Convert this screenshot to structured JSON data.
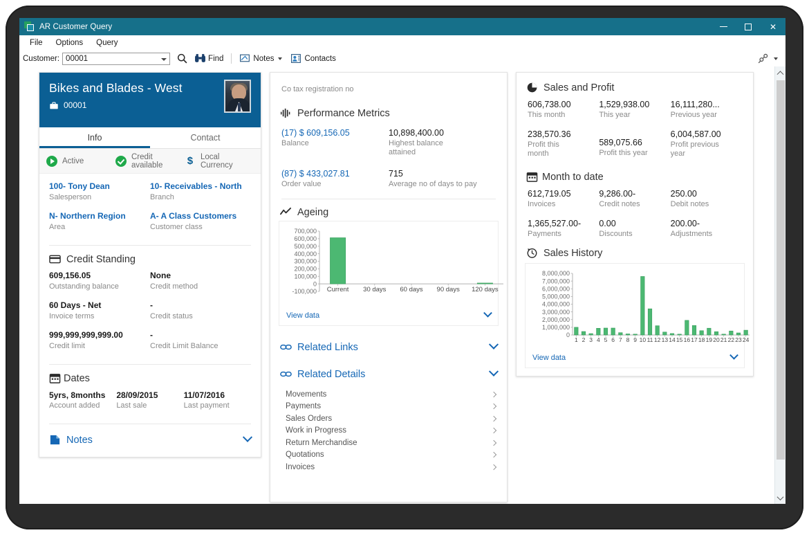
{
  "window": {
    "title": "AR Customer Query",
    "app_icon": "app-window-icon",
    "minimize": "minimize-icon",
    "maximize": "maximize-icon",
    "close": "close-icon"
  },
  "menubar": {
    "items": [
      {
        "label": "File",
        "accel": "F"
      },
      {
        "label": "Options",
        "accel": "O"
      },
      {
        "label": "Query",
        "accel": "Q"
      }
    ]
  },
  "toolbar": {
    "customer_label": "Customer:",
    "customer_value": "00001",
    "customer_placeholder": "Customer",
    "search_icon": "search-icon",
    "find_label": "Find",
    "find_icon": "binoculars-icon",
    "notes_label": "Notes",
    "notes_icon": "notes-icon",
    "contacts_label": "Contacts",
    "contacts_icon": "contacts-icon",
    "right_icon": "link-key-icon"
  },
  "customer_card": {
    "name": "Bikes and Blades - West",
    "code": "00001",
    "code_icon": "briefcase-icon",
    "avatar": "customer-avatar",
    "tabs": [
      {
        "label": "Info",
        "active": true
      },
      {
        "label": "Contact",
        "active": false
      }
    ],
    "status": [
      {
        "label": "Active",
        "icon": "play-circle-icon"
      },
      {
        "label": "Credit available",
        "icon": "check-circle-icon"
      },
      {
        "label": "Local Currency",
        "icon": "dollar-icon"
      }
    ],
    "attributes": [
      {
        "value": "100- Tony Dean",
        "label": "Salesperson",
        "link": true
      },
      {
        "value": "10- Receivables - North",
        "label": "Branch",
        "link": true
      },
      {
        "value": "N- Northern Region",
        "label": "Area",
        "link": true
      },
      {
        "value": "A- A Class Customers",
        "label": "Customer class",
        "link": true
      }
    ],
    "credit_standing": {
      "title": "Credit Standing",
      "icon": "credit-card-icon",
      "items": [
        {
          "value": "609,156.05",
          "label": "Outstanding balance"
        },
        {
          "value": "None",
          "label": "Credit method"
        },
        {
          "value": "60 Days - Net",
          "label": "Invoice terms"
        },
        {
          "value": "-",
          "label": "Credit status"
        },
        {
          "value": "999,999,999,999.00",
          "label": "Credit limit"
        },
        {
          "value": "-",
          "label": "Credit Limit Balance"
        }
      ]
    },
    "dates": {
      "title": "Dates",
      "icon": "calendar-icon",
      "items": [
        {
          "value": "5yrs, 8months",
          "label": "Account added"
        },
        {
          "value": "28/09/2015",
          "label": "Last sale"
        },
        {
          "value": "11/07/2016",
          "label": "Last payment"
        }
      ]
    },
    "notes": {
      "title": "Notes",
      "icon": "note-page-icon",
      "chevron": "chevron-down-icon"
    }
  },
  "middle_card": {
    "co_tax_label": "Co tax registration no",
    "performance": {
      "title": "Performance Metrics",
      "icon": "bar-levels-icon",
      "items": [
        {
          "value": "(17) $ 609,156.05",
          "label": "Balance",
          "link": true
        },
        {
          "value": "10,898,400.00",
          "label": "Highest balance attained",
          "link": false
        },
        {
          "value": "(87) $ 433,027.81",
          "label": "Order value",
          "link": true
        },
        {
          "value": "715",
          "label": "Average no of days to pay",
          "link": false
        }
      ]
    },
    "ageing": {
      "title": "Ageing",
      "icon": "trend-line-icon",
      "view_data": "View data",
      "chevron": "chevron-down-icon"
    },
    "related_links": {
      "title": "Related Links",
      "icon": "link-icon",
      "chevron": "chevron-down-icon"
    },
    "related_details": {
      "title": "Related Details",
      "icon": "link-icon",
      "chevron": "chevron-down-icon",
      "items": [
        "Movements",
        "Payments",
        "Sales Orders",
        "Work in Progress",
        "Return Merchandise",
        "Quotations",
        "Invoices"
      ]
    }
  },
  "right_card": {
    "sales_and_profit": {
      "title": "Sales and Profit",
      "icon": "pie-chart-icon",
      "items": [
        {
          "value": "606,738.00",
          "label": "This month"
        },
        {
          "value": "1,529,938.00",
          "label": "This year"
        },
        {
          "value": "16,111,280...",
          "label": "Previous year"
        },
        {
          "value": "238,570.36",
          "label": "Profit this month"
        },
        {
          "value": "589,075.66",
          "label": "Profit this year"
        },
        {
          "value": "6,004,587.00",
          "label": "Profit previous year"
        }
      ]
    },
    "month_to_date": {
      "title": "Month to date",
      "icon": "calendar-icon",
      "items": [
        {
          "value": "612,719.05",
          "label": "Invoices"
        },
        {
          "value": "9,286.00-",
          "label": "Credit notes"
        },
        {
          "value": "250.00",
          "label": "Debit notes"
        },
        {
          "value": "1,365,527.00-",
          "label": "Payments"
        },
        {
          "value": "0.00",
          "label": "Discounts"
        },
        {
          "value": "200.00-",
          "label": "Adjustments"
        }
      ]
    },
    "sales_history": {
      "title": "Sales History",
      "icon": "clock-history-icon",
      "view_data": "View data",
      "chevron": "chevron-down-icon"
    }
  },
  "colors": {
    "titlebar": "#16708a",
    "card_header": "#0b5f94",
    "link": "#1567b5",
    "bar_green": "#4cb872",
    "status_green": "#1fa94a"
  },
  "scrollbar": {
    "up": "scroll-up-arrow",
    "down": "scroll-down-arrow",
    "thumb": "scroll-thumb"
  },
  "chart_data": [
    {
      "id": "ageing",
      "type": "bar",
      "title": "Ageing",
      "categories": [
        "Current",
        "30 days",
        "60 days",
        "90 days",
        "120 days"
      ],
      "values": [
        612719,
        0,
        0,
        0,
        9286
      ],
      "yticks": [
        "-100,000",
        "0",
        "100,000",
        "200,000",
        "300,000",
        "400,000",
        "500,000",
        "600,000",
        "700,000"
      ],
      "ylim": [
        -100000,
        700000
      ],
      "xlabel": "",
      "ylabel": "",
      "grid": false,
      "legend": "none",
      "series_color": "#4cb872"
    },
    {
      "id": "sales-history",
      "type": "bar",
      "title": "Sales History",
      "categories": [
        "1",
        "2",
        "3",
        "4",
        "5",
        "6",
        "7",
        "8",
        "9",
        "10",
        "11",
        "12",
        "13",
        "14",
        "15",
        "16",
        "17",
        "18",
        "19",
        "20",
        "21",
        "22",
        "23",
        "24"
      ],
      "values": [
        1000000,
        450000,
        180000,
        870000,
        900000,
        900000,
        300000,
        140000,
        110000,
        7600000,
        3400000,
        1200000,
        380000,
        190000,
        70000,
        1900000,
        1230000,
        560000,
        880000,
        430000,
        110000,
        520000,
        270000,
        620000
      ],
      "yticks": [
        "0",
        "1,000,000",
        "2,000,000",
        "3,000,000",
        "4,000,000",
        "5,000,000",
        "6,000,000",
        "7,000,000",
        "8,000,000"
      ],
      "ylim": [
        0,
        8000000
      ],
      "xlabel": "",
      "ylabel": "",
      "grid": false,
      "legend": "none",
      "series_color": "#4cb872"
    }
  ]
}
